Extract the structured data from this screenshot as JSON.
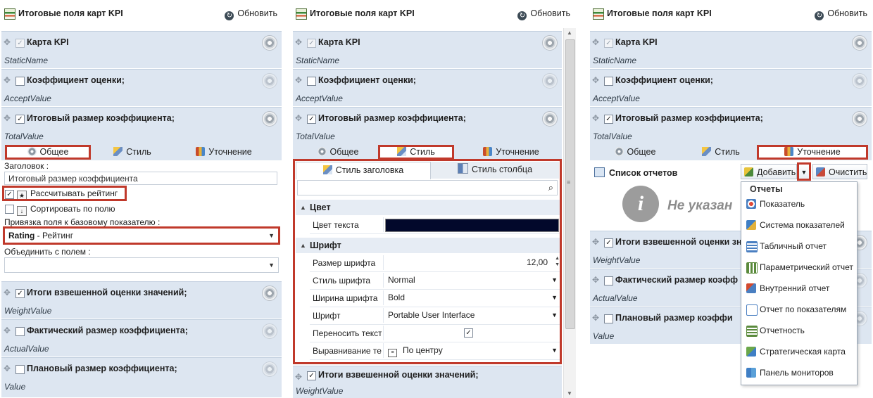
{
  "header": {
    "title": "Итоговые поля карт KPI",
    "refresh": "Обновить"
  },
  "fields": [
    {
      "title": "Карта KPI",
      "static_name": "StaticName",
      "checked": true,
      "locked": true
    },
    {
      "title": "Коэффициент оценки;",
      "static_name": "AcceptValue",
      "checked": false
    },
    {
      "title": "Итоговый размер коэффициента;",
      "static_name": "TotalValue",
      "checked": true
    },
    {
      "title": "Итоги взвешенной оценки значений;",
      "static_name": "WeightValue",
      "checked": true
    },
    {
      "title": "Фактический размер коэффициента;",
      "static_name": "ActualValue",
      "checked": false
    },
    {
      "title": "Плановый размер коэффициента;",
      "static_name": "Value",
      "checked": false
    }
  ],
  "tabs": {
    "general": "Общее",
    "style": "Стиль",
    "refine": "Уточнение"
  },
  "general": {
    "caption_label": "Заголовок :",
    "caption_value": "Итоговый размер коэффициента",
    "calc_rating": "Рассчитывать рейтинг",
    "sort_by_field": "Сортировать по полю",
    "binding_label": "Привязка поля к базовому показателю :",
    "binding_code": "Rating",
    "binding_name": " - Рейтинг",
    "merge_label": "Объединить с полем :"
  },
  "style_editor": {
    "tab_header": "Стиль заголовка",
    "tab_column": "Стиль столбца",
    "search_placeholder": "",
    "section_color": "Цвет",
    "text_color_label": "Цвет текста",
    "text_color_value": "#02082b",
    "section_font": "Шрифт",
    "font_size_label": "Размер шрифта",
    "font_size_value": "12,00",
    "font_style_label": "Стиль шрифта",
    "font_style_value": "Normal",
    "font_weight_label": "Ширина шрифта",
    "font_weight_value": "Bold",
    "font_label": "Шрифт",
    "font_value": "Portable User Interface",
    "wrap_label": "Переносить текст",
    "align_label": "Выравнивание те",
    "align_value": "По центру"
  },
  "refine": {
    "reports_list": "Список отчетов",
    "add": "Добавить",
    "clear": "Очистить",
    "not_specified": "Не указан",
    "menu_header": "Отчеты",
    "menu_items": [
      "Показатель",
      "Система показателей",
      "Табличный отчет",
      "Параметрический отчет",
      "Внутренний отчет",
      "Отчет по показателям",
      "Отчетность",
      "Стратегическая карта",
      "Панель мониторов"
    ],
    "truncated_titles": {
      "weight": "Итоги взвешенной оценки зн",
      "actual": "Фактический размер коэфф",
      "planned": "Плановый размер коэффи"
    }
  },
  "colors": {
    "highlight": "#c0392b",
    "field_bg": "#dde6f1"
  }
}
